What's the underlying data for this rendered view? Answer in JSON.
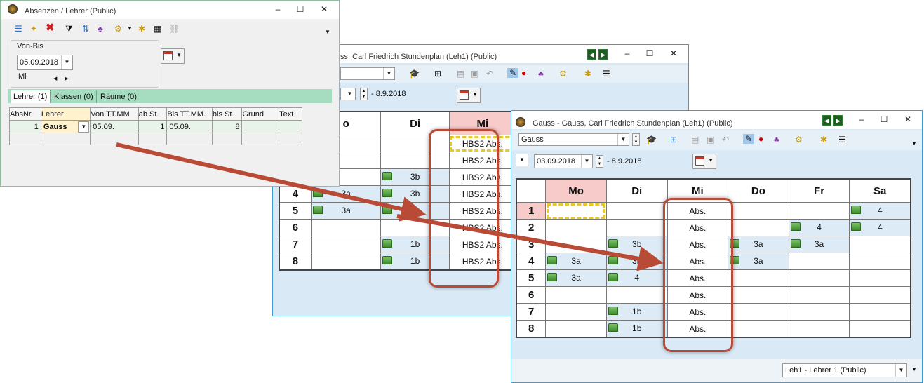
{
  "absenzen": {
    "title": "Absenzen / Lehrer (Public)",
    "group_label": "Von-Bis",
    "date": "05.09.2018",
    "day": "Mi",
    "tabs": [
      "Lehrer (1)",
      "Klassen (0)",
      "Räume (0)"
    ],
    "columns": [
      "AbsNr.",
      "Lehrer",
      "Von TT.MM",
      "ab St.",
      "Bis TT.MM.",
      "bis St.",
      "Grund",
      "Text"
    ],
    "row": {
      "absnr": "1",
      "lehrer": "Gauss",
      "von": "05.09.",
      "ab_st": "1",
      "bis": "05.09.",
      "bis_st": "8",
      "grund": "",
      "text": ""
    }
  },
  "back_window": {
    "title": "ss, Carl Friedrich  Stundenplan  (Leh1) (Public)",
    "date_range": "- 8.9.2018",
    "days": [
      "o",
      "Di",
      "Mi"
    ],
    "rows": [
      {
        "n": "",
        "mo": "",
        "di": "",
        "mi": "HBS2 Abs."
      },
      {
        "n": "",
        "mo": "",
        "di": "",
        "mi": "HBS2 Abs."
      },
      {
        "n": "",
        "mo": "",
        "di": "3b",
        "mi": "HBS2 Abs."
      },
      {
        "n": "4",
        "mo": "3a",
        "di": "3b",
        "mi": "HBS2 Abs."
      },
      {
        "n": "5",
        "mo": "3a",
        "di": "",
        "mi": "HBS2 Abs."
      },
      {
        "n": "6",
        "mo": "",
        "di": "",
        "mi": "HBS2 Abs."
      },
      {
        "n": "7",
        "mo": "",
        "di": "1b",
        "mi": "HBS2 Abs."
      },
      {
        "n": "8",
        "mo": "",
        "di": "1b",
        "mi": "HBS2 Abs."
      }
    ]
  },
  "front_window": {
    "title": "Gauss - Gauss, Carl Friedrich  Stundenplan  (Leh1) (Public)",
    "teacher_combo": "Gauss",
    "date": "03.09.2018",
    "date_range": "- 8.9.2018",
    "days": [
      "Mo",
      "Di",
      "Mi",
      "Do",
      "Fr",
      "Sa"
    ],
    "rows": [
      {
        "n": "1",
        "mo": "",
        "di": "",
        "mi": "Abs.",
        "do": "",
        "fr": "",
        "sa": "4"
      },
      {
        "n": "2",
        "mo": "",
        "di": "",
        "mi": "Abs.",
        "do": "",
        "fr": "4",
        "sa": "4"
      },
      {
        "n": "3",
        "mo": "",
        "di": "3b",
        "mi": "Abs.",
        "do": "3a",
        "fr": "3a",
        "sa": ""
      },
      {
        "n": "4",
        "mo": "3a",
        "di": "3b",
        "mi": "Abs.",
        "do": "3a",
        "fr": "",
        "sa": ""
      },
      {
        "n": "5",
        "mo": "3a",
        "di": "4",
        "mi": "Abs.",
        "do": "",
        "fr": "",
        "sa": ""
      },
      {
        "n": "6",
        "mo": "",
        "di": "",
        "mi": "Abs.",
        "do": "",
        "fr": "",
        "sa": ""
      },
      {
        "n": "7",
        "mo": "",
        "di": "1b",
        "mi": "Abs.",
        "do": "",
        "fr": "",
        "sa": ""
      },
      {
        "n": "8",
        "mo": "",
        "di": "1b",
        "mi": "Abs.",
        "do": "",
        "fr": "",
        "sa": ""
      }
    ],
    "status_combo": "Leh1 - Lehrer 1 (Public)"
  },
  "colors": {
    "accent": "#b84a36",
    "header_pink": "#f8cbcb",
    "cell_blue": "#dcebf6",
    "tab_green": "#a6dcc0"
  }
}
